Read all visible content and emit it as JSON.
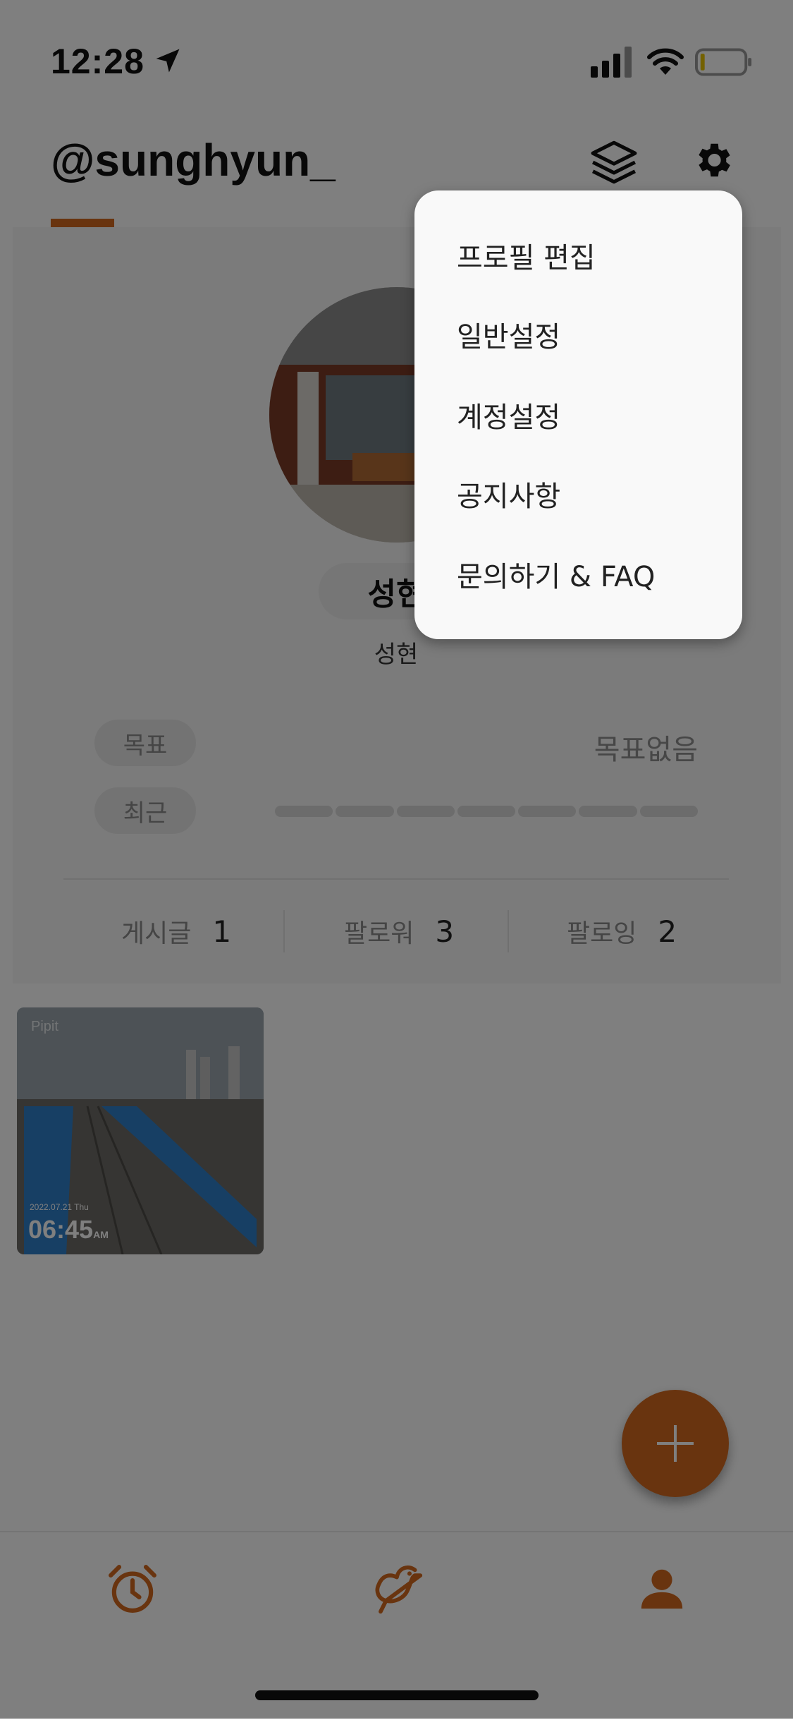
{
  "status_bar": {
    "time": "12:28"
  },
  "header": {
    "username": "@sunghyun_"
  },
  "profile": {
    "display_name": "성현",
    "sub_name": "성현",
    "goal_label": "목표",
    "goal_value": "목표없음",
    "recent_label": "최근"
  },
  "stats": [
    {
      "label": "게시글",
      "value": "1"
    },
    {
      "label": "팔로워",
      "value": "3"
    },
    {
      "label": "팔로잉",
      "value": "2"
    }
  ],
  "post": {
    "brand": "Pipit",
    "date": "2022.07.21 Thu",
    "time": "06:45",
    "ampm": "AM"
  },
  "menu": {
    "items": [
      "프로필 편집",
      "일반설정",
      "계정설정",
      "공지사항",
      "문의하기 & FAQ"
    ]
  },
  "colors": {
    "accent": "#d2691e",
    "overlay": "rgba(0,0,0,0.5)"
  },
  "icons": [
    "location-arrow-icon",
    "signal-icon",
    "wifi-icon",
    "battery-icon",
    "layers-icon",
    "gear-icon",
    "plus-icon",
    "alarm-clock-icon",
    "bird-icon",
    "person-icon"
  ]
}
